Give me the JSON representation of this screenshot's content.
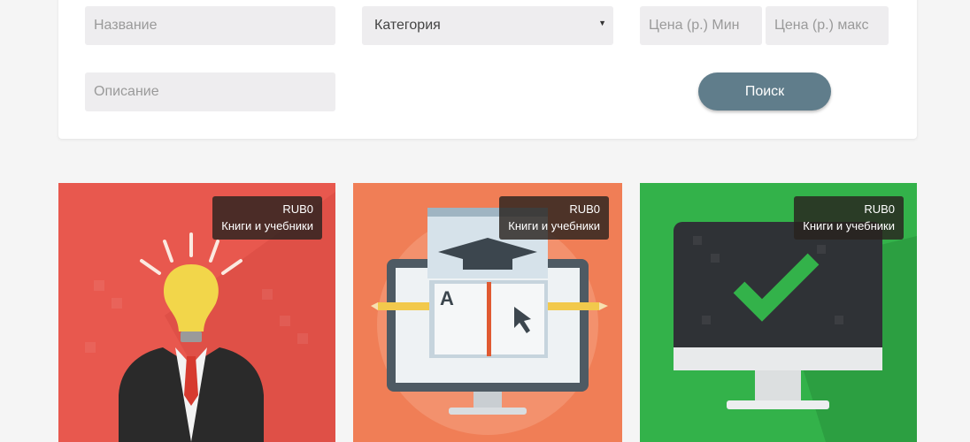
{
  "filters": {
    "name_placeholder": "Название",
    "category_selected": "Категория",
    "price_min_placeholder": "Цена (р.) Мин",
    "price_max_placeholder": "Цена (р.) макс",
    "description_placeholder": "Описание",
    "search_label": "Поиск"
  },
  "products": [
    {
      "price": "RUB0",
      "category": "Книги и учебники",
      "icon": "lightbulb-businessman-icon",
      "bg_color": "#e8584e"
    },
    {
      "price": "RUB0",
      "category": "Книги и учебники",
      "icon": "online-education-icon",
      "bg_color": "#f07e56"
    },
    {
      "price": "RUB0",
      "category": "Книги и учебники",
      "icon": "monitor-checkmark-icon",
      "bg_color": "#33b24a"
    }
  ],
  "colors": {
    "page_bg": "#f5f5f5",
    "input_bg": "#eeedef",
    "search_button": "#607d8b"
  }
}
